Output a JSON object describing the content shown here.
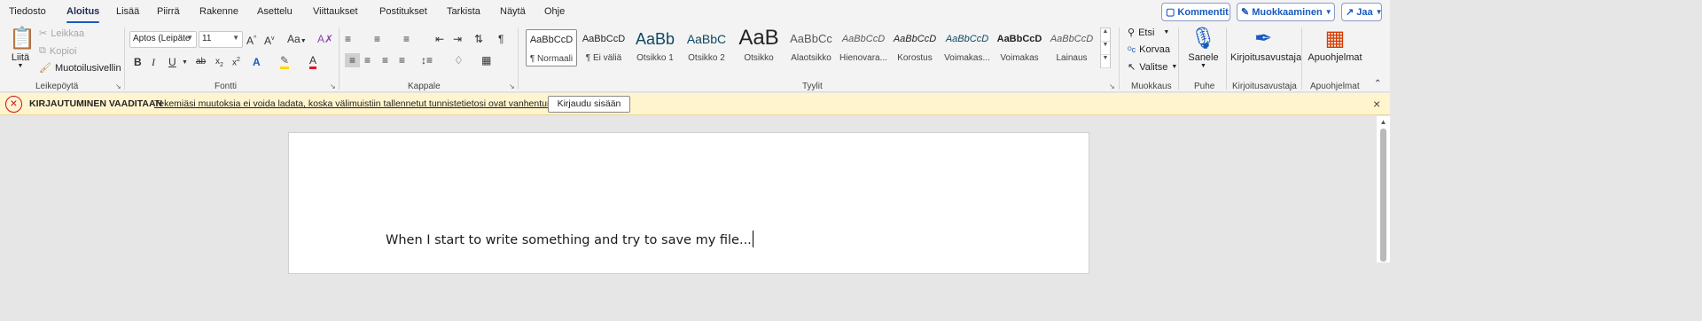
{
  "tabs": [
    "Tiedosto",
    "Aloitus",
    "Lisää",
    "Piirrä",
    "Rakenne",
    "Asettelu",
    "Viittaukset",
    "Postitukset",
    "Tarkista",
    "Näytä",
    "Ohje"
  ],
  "active_tab": "Aloitus",
  "top_actions": {
    "comment": "Kommentit",
    "editing": "Muokkaaminen",
    "share": "Jaa"
  },
  "clipboard": {
    "paste": "Liitä",
    "cut": "Leikkaa",
    "copy": "Kopioi",
    "format_painter": "Muotoilusivellin",
    "label": "Leikepöytä"
  },
  "font": {
    "name": "Aptos (Leipäte",
    "size": "11",
    "label": "Fontti"
  },
  "paragraph": {
    "label": "Kappale"
  },
  "styles": {
    "label": "Tyylit",
    "items": [
      {
        "preview": "AaBbCcD",
        "name": "¶ Normaali"
      },
      {
        "preview": "AaBbCcD",
        "name": "¶ Ei väliä"
      },
      {
        "preview": "AaBb",
        "name": "Otsikko 1"
      },
      {
        "preview": "AaBbC",
        "name": "Otsikko 2"
      },
      {
        "preview": "AaB",
        "name": "Otsikko"
      },
      {
        "preview": "AaBbCc",
        "name": "Alaotsikko"
      },
      {
        "preview": "AaBbCcD",
        "name": "Hienovara..."
      },
      {
        "preview": "AaBbCcD",
        "name": "Korostus"
      },
      {
        "preview": "AaBbCcD",
        "name": "Voimakas..."
      },
      {
        "preview": "AaBbCcD",
        "name": "Voimakas"
      },
      {
        "preview": "AaBbCcD",
        "name": "Lainaus"
      }
    ]
  },
  "editing": {
    "find": "Etsi",
    "replace": "Korvaa",
    "select": "Valitse",
    "label": "Muokkaus"
  },
  "voice": {
    "dictate": "Sanele",
    "label": "Puhe"
  },
  "editor": {
    "button": "Kirjoitusavustaja",
    "label": "Kirjoitusavustaja"
  },
  "addins": {
    "button": "Apuohjelmat",
    "label": "Apuohjelmat"
  },
  "message_bar": {
    "title": "KIRJAUTUMINEN VAADITAAN",
    "text": "Tekemiäsi muutoksia ei voida ladata, koska välimuistiin tallennetut tunnistetietosi ovat vanhentuneet.",
    "button": "Kirjaudu sisään"
  },
  "document": {
    "text": "When I start to write something and try to save my file..."
  },
  "colors": {
    "accent": "#185abd",
    "message_bg": "#fff4ce",
    "error": "#c50f1f",
    "highlight": "#ffd700",
    "font_color": "#e81123"
  }
}
